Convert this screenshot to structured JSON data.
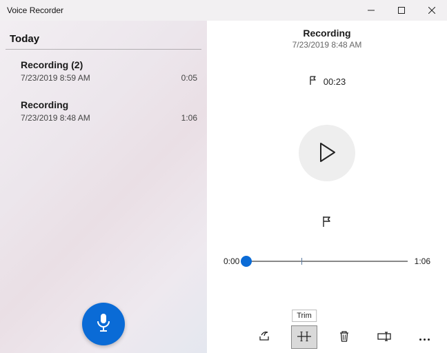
{
  "window": {
    "title": "Voice Recorder"
  },
  "sidebar": {
    "group_label": "Today",
    "items": [
      {
        "name": "Recording (2)",
        "timestamp": "7/23/2019 8:59 AM",
        "duration": "0:05"
      },
      {
        "name": "Recording",
        "timestamp": "7/23/2019 8:48 AM",
        "duration": "1:06"
      }
    ]
  },
  "main": {
    "title": "Recording",
    "timestamp": "7/23/2019 8:48 AM",
    "marker_time": "00:23",
    "time_start": "0:00",
    "time_end": "1:06"
  },
  "tooltip": {
    "trim": "Trim"
  }
}
